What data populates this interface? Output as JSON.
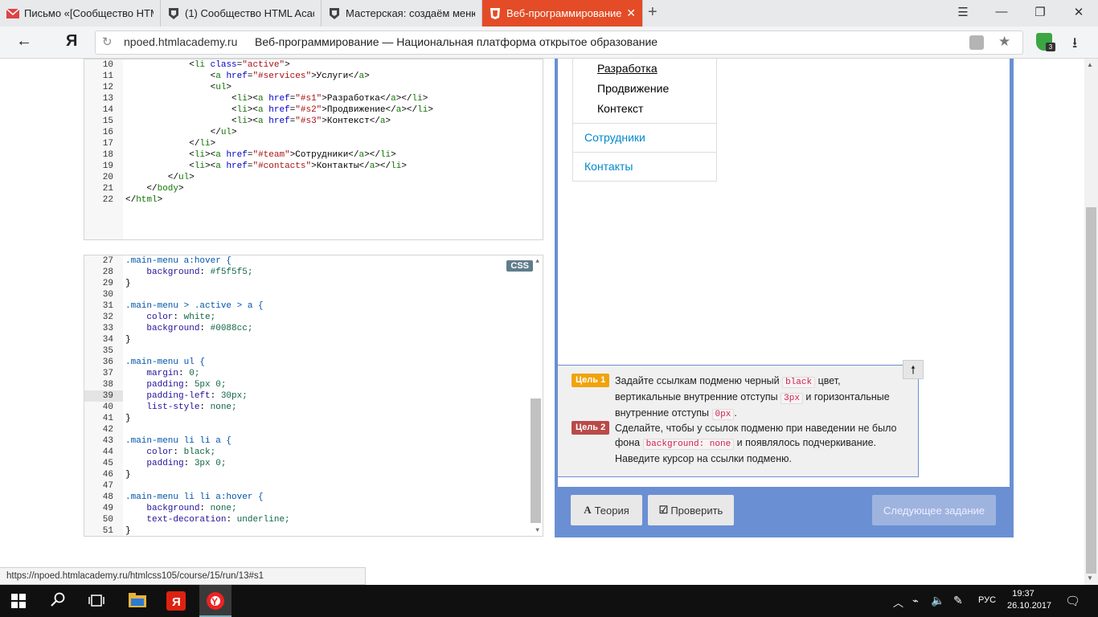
{
  "browser": {
    "tabs": [
      {
        "title": "Письмо «[Сообщество HTML",
        "icon": "mail-icon",
        "active": false
      },
      {
        "title": "(1) Сообщество HTML Acad",
        "icon": "htmlacademy-icon",
        "active": false
      },
      {
        "title": "Мастерская: создаём меню",
        "icon": "htmlacademy-icon",
        "active": false
      },
      {
        "title": "Веб-программирование",
        "icon": "html5-icon",
        "active": true
      }
    ],
    "yandex_button": "Я",
    "url": "npoed.htmlacademy.ru",
    "page_title": "Веб-программирование — Национальная платформа открытое образование",
    "shield_badge": "3",
    "status_url": "https://npoed.htmlacademy.ru/htmlcss105/course/15/run/13#s1"
  },
  "html_editor": {
    "lines": [
      {
        "n": "10",
        "code": "            <li class=\"active\">"
      },
      {
        "n": "11",
        "code": "                <a href=\"#services\">Услуги</a>"
      },
      {
        "n": "12",
        "code": "                <ul>"
      },
      {
        "n": "13",
        "code": "                    <li><a href=\"#s1\">Разработка</a></li>"
      },
      {
        "n": "14",
        "code": "                    <li><a href=\"#s2\">Продвижение</a></li>"
      },
      {
        "n": "15",
        "code": "                    <li><a href=\"#s3\">Контекст</a>"
      },
      {
        "n": "16",
        "code": "                </ul>"
      },
      {
        "n": "17",
        "code": "            </li>"
      },
      {
        "n": "18",
        "code": "            <li><a href=\"#team\">Сотрудники</a></li>"
      },
      {
        "n": "19",
        "code": "            <li><a href=\"#contacts\">Контакты</a></li>"
      },
      {
        "n": "20",
        "code": "        </ul>"
      },
      {
        "n": "21",
        "code": "    </body>"
      },
      {
        "n": "22",
        "code": "</html>"
      }
    ]
  },
  "css_editor": {
    "tag": "CSS",
    "highlighted_line": "39",
    "lines": [
      {
        "n": "27",
        "code": ".main-menu a:hover {"
      },
      {
        "n": "28",
        "code": "    background: #f5f5f5;"
      },
      {
        "n": "29",
        "code": "}"
      },
      {
        "n": "30",
        "code": ""
      },
      {
        "n": "31",
        "code": ".main-menu > .active > a {"
      },
      {
        "n": "32",
        "code": "    color: white;"
      },
      {
        "n": "33",
        "code": "    background: #0088cc;"
      },
      {
        "n": "34",
        "code": "}"
      },
      {
        "n": "35",
        "code": ""
      },
      {
        "n": "36",
        "code": ".main-menu ul {"
      },
      {
        "n": "37",
        "code": "    margin: 0;"
      },
      {
        "n": "38",
        "code": "    padding: 5px 0;"
      },
      {
        "n": "39",
        "code": "    padding-left: 30px;"
      },
      {
        "n": "40",
        "code": "    list-style: none;"
      },
      {
        "n": "41",
        "code": "}"
      },
      {
        "n": "42",
        "code": ""
      },
      {
        "n": "43",
        "code": ".main-menu li li a {"
      },
      {
        "n": "44",
        "code": "    color: black;"
      },
      {
        "n": "45",
        "code": "    padding: 3px 0;"
      },
      {
        "n": "46",
        "code": "}"
      },
      {
        "n": "47",
        "code": ""
      },
      {
        "n": "48",
        "code": ".main-menu li li a:hover {"
      },
      {
        "n": "49",
        "code": "    background: none;"
      },
      {
        "n": "50",
        "code": "    text-decoration: underline;"
      },
      {
        "n": "51",
        "code": "}"
      }
    ]
  },
  "preview": {
    "submenu": [
      "Разработка",
      "Продвижение",
      "Контекст"
    ],
    "menu": [
      "Сотрудники",
      "Контакты"
    ]
  },
  "goals": [
    {
      "badge": "Цель 1",
      "color": "#f0a30a",
      "parts": [
        "Задайте ссылкам подменю черный ",
        "black",
        " цвет, вертикальные внутренние отступы ",
        "3px",
        " и горизонтальные внутренние отступы ",
        "0px",
        "."
      ]
    },
    {
      "badge": "Цель 2",
      "color": "#b94a48",
      "parts": [
        "Сделайте, чтобы у ссылок подменю при наведении не было фона ",
        "background: none",
        " и появлялось подчеркивание. Наведите курсор на ссылки подменю."
      ]
    }
  ],
  "buttons": {
    "theory": "Теория",
    "check": "Проверить",
    "next": "Следующее задание"
  },
  "taskbar": {
    "lang": "РУС",
    "time": "19:37",
    "date": "26.10.2017"
  }
}
